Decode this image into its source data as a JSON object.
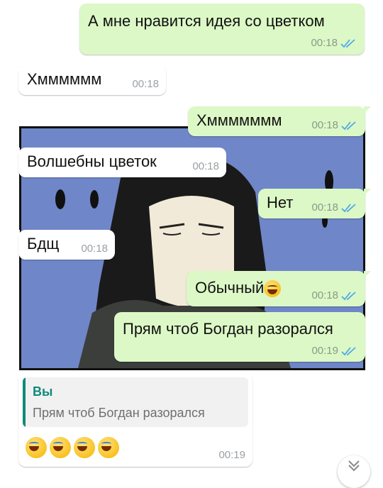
{
  "messages": [
    {
      "text": "А мне нравится идея со цветком",
      "time": "00:18"
    },
    {
      "text": "Хмммммм",
      "time": "00:18"
    },
    {
      "text": "Хммммммм",
      "time": "00:18"
    },
    {
      "text": "Волшебны цветок",
      "time": "00:18"
    },
    {
      "text": "Нет",
      "time": "00:18"
    },
    {
      "text": "Бдщ",
      "time": "00:18"
    },
    {
      "text": "Обычный",
      "time": "00:18",
      "emoji": "grinning-squinting-face"
    },
    {
      "text": "Прям чтоб Богдан разорался",
      "time": "00:19"
    }
  ],
  "reply": {
    "quote_author": "Вы",
    "quote_text": "Прям чтоб Богдан разорался",
    "emojis": [
      "face-with-tears-of-joy",
      "face-with-tears-of-joy",
      "face-with-tears-of-joy",
      "face-with-tears-of-joy"
    ],
    "time": "00:19"
  },
  "colors": {
    "outgoing": "#dcf8c6",
    "incoming": "#ffffff",
    "read_ticks": "#4fa9e6",
    "quote_accent": "#0f8a7c"
  }
}
